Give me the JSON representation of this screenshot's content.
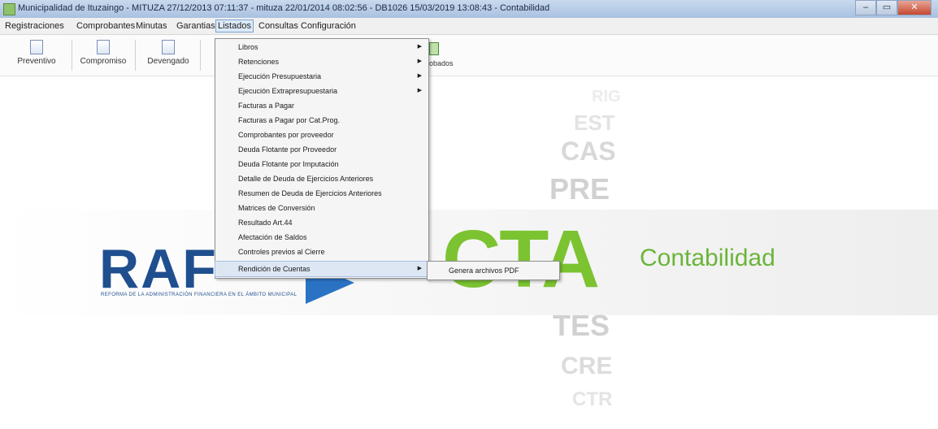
{
  "window": {
    "title": "Municipalidad de Ituzaingo - MITUZA 27/12/2013 07:11:37 - mituza 22/01/2014 08:02:56 - DB1026 15/03/2019 13:08:43 - Contabilidad"
  },
  "menubar": {
    "items": [
      "Registraciones",
      "Comprobantes",
      "Minutas",
      "Garantias",
      "Listados",
      "Consultas",
      "Configuración"
    ]
  },
  "toolbar": {
    "buttons": [
      "Preventivo",
      "Compromiso",
      "Devengado"
    ],
    "partial_label": "obados"
  },
  "listados_menu": {
    "items": [
      {
        "label": "Libros",
        "submenu": true
      },
      {
        "label": "Retenciones",
        "submenu": true
      },
      {
        "label": "Ejecución Presupuestaria",
        "submenu": true
      },
      {
        "label": "Ejecución Extrapresupuestaria",
        "submenu": true
      },
      {
        "label": "Facturas a Pagar",
        "submenu": false
      },
      {
        "label": "Facturas a Pagar por Cat.Prog.",
        "submenu": false
      },
      {
        "label": "Comprobantes por proveedor",
        "submenu": false
      },
      {
        "label": "Deuda Flotante por Proveedor",
        "submenu": false
      },
      {
        "label": "Deuda Flotante por Imputación",
        "submenu": false
      },
      {
        "label": "Detalle de Deuda de Ejercicios Anteriores",
        "submenu": false
      },
      {
        "label": "Resumen de Deuda de Ejercicios Anteriores",
        "submenu": false
      },
      {
        "label": "Matrices de Conversión",
        "submenu": false
      },
      {
        "label": "Resultado Art.44",
        "submenu": false
      },
      {
        "label": "Afectación de Saldos",
        "submenu": false
      },
      {
        "label": "Controles previos al Cierre",
        "submenu": false
      },
      {
        "label": "Rendición de Cuentas",
        "submenu": true
      }
    ],
    "submenu_item": "Genera archivos PDF"
  },
  "background": {
    "ghost_words": [
      "RIG",
      "EST",
      "CAS",
      "PRE",
      "TES",
      "CRE",
      "CTR"
    ],
    "raf_logo": "RAF",
    "raf_tagline": "REFORMA DE LA ADMINISTRACIÓN FINANCIERA EN EL ÁMBITO MUNICIPAL",
    "cta_logo": "CTA",
    "cta_subtitle": "Contabilidad"
  },
  "colors": {
    "raf_blue": "#1f4f8f",
    "cta_green": "#7cc331",
    "menu_highlight": "#dde7f4"
  }
}
